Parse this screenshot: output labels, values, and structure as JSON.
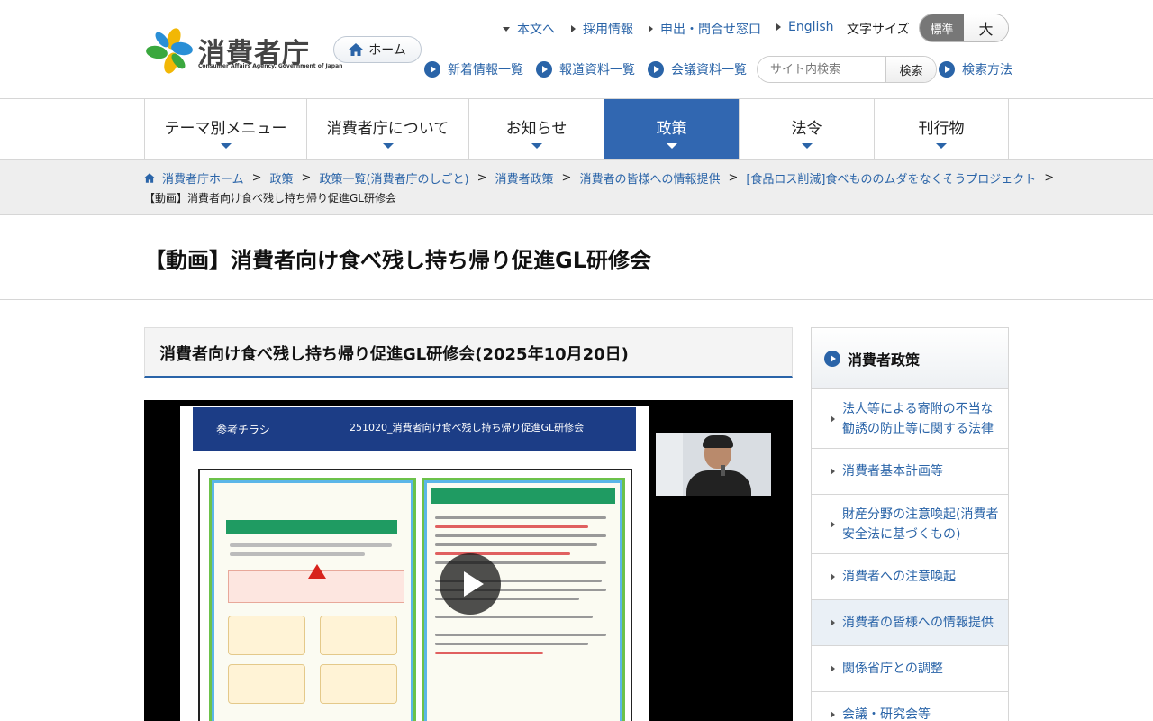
{
  "header": {
    "logo_text": "消費者庁",
    "logo_sub": "Consumer Affairs Agency, Government of Japan",
    "home_label": "ホーム",
    "top_links": {
      "main_content": "本文へ",
      "recruit": "採用情報",
      "contact": "申出・問合せ窓口",
      "english": "English"
    },
    "font_size_label": "文字サイズ",
    "font_size_standard": "標準",
    "font_size_large": "大",
    "sub_links": {
      "news": "新着情報一覧",
      "press": "報道資料一覧",
      "meetings": "会議資料一覧",
      "search_help": "検索方法"
    },
    "search_placeholder": "サイト内検索",
    "search_button": "検索"
  },
  "gnav": {
    "items": [
      {
        "label": "テーマ別メニュー"
      },
      {
        "label": "消費者庁について"
      },
      {
        "label": "お知らせ"
      },
      {
        "label": "政策"
      },
      {
        "label": "法令"
      },
      {
        "label": "刊行物"
      }
    ],
    "active_index": 3
  },
  "breadcrumb": {
    "items": [
      "消費者庁ホーム",
      "政策",
      "政策一覧(消費者庁のしごと)",
      "消費者政策",
      "消費者の皆様への情報提供",
      "[食品ロス削減]食べもののムダをなくそうプロジェクト"
    ],
    "separator": ">",
    "current": "【動画】消費者向け食べ残し持ち帰り促進GL研修会"
  },
  "page_title": "【動画】消費者向け食べ残し持ち帰り促進GL研修会",
  "main": {
    "section_heading": "消費者向け食べ残し持ち帰り促進GL研修会(2025年10月20日)",
    "video": {
      "slide_label": "参考チラシ",
      "slide_title": "251020_消費者向け食べ残し持ち帰り促進GL研修会"
    }
  },
  "sidebar": {
    "title": "消費者政策",
    "items": [
      {
        "label": "法人等による寄附の不当な勧誘の防止等に関する法律"
      },
      {
        "label": "消費者基本計画等"
      },
      {
        "label": "財産分野の注意喚起(消費者安全法に基づくもの)"
      },
      {
        "label": "消費者への注意喚起"
      },
      {
        "label": "消費者の皆様への情報提供"
      },
      {
        "label": "関係省庁との調整"
      },
      {
        "label": "会議・研究会等"
      }
    ],
    "active_index": 4
  },
  "colors": {
    "accent": "#3167b1",
    "link": "#2a64a8",
    "breadcrumb_bg": "#eeeeee"
  }
}
